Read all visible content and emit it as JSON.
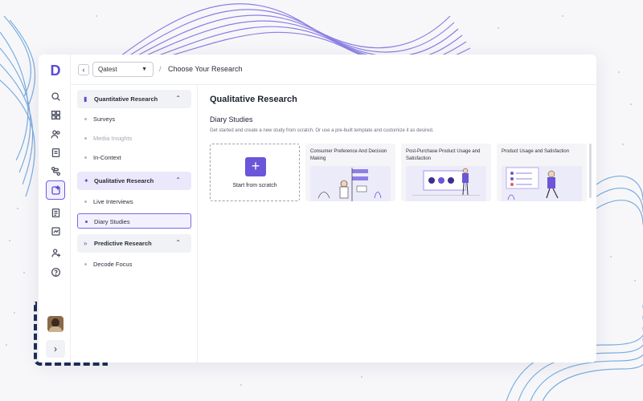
{
  "colors": {
    "accent": "#5b4bd6",
    "dash": "#1a2e55",
    "wave_blue": "#5b9bd8",
    "wave_purple": "#7a6be0"
  },
  "rail": {
    "logo": "D",
    "icons": [
      "search-icon",
      "grid-icon",
      "users-icon",
      "document-icon",
      "flow-icon",
      "research-icon",
      "notes-icon",
      "chart-icon",
      "add-user-icon",
      "help-icon"
    ],
    "expand_label": "›"
  },
  "topbar": {
    "back_label": "‹",
    "project_value": "Qatest",
    "separator": "/",
    "title": "Choose Your Research"
  },
  "sidebar": {
    "categories": [
      {
        "label": "Quantitative Research",
        "items": [
          "Surveys",
          "Media Insights",
          "In-Context"
        ]
      },
      {
        "label": "Qualitative Research",
        "items": [
          "Live Interviews",
          "Diary Studies"
        ]
      },
      {
        "label": "Predictive Research",
        "items": [
          "Decode Focus"
        ]
      }
    ],
    "selected_item": "Diary Studies",
    "muted_item": "Media Insights"
  },
  "main": {
    "heading": "Qualitative Research",
    "subheading": "Diary Studies",
    "description": "Get started and create a new study from scratch. Or use a pre-built template and customize it as desired.",
    "start_label": "Start from scratch",
    "templates": [
      {
        "title": "Consumer Preference And Decision Making"
      },
      {
        "title": "Post-Purchase Product Usage and Satisfaction"
      },
      {
        "title": "Product Usage and Satisfaction"
      }
    ]
  }
}
